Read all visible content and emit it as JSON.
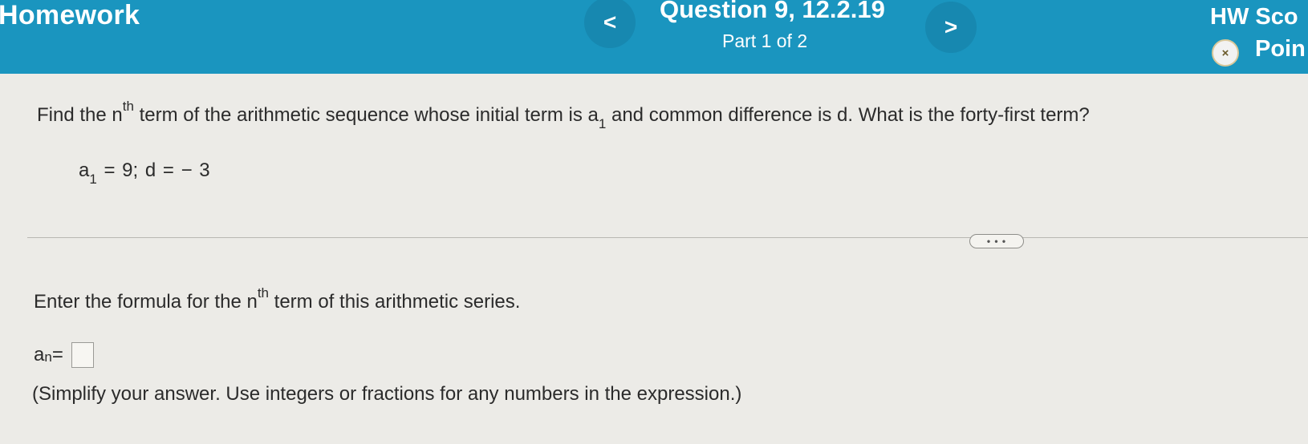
{
  "header": {
    "title": "Homework",
    "prev_label": "<",
    "next_label": ">",
    "question_title": "Question 9, 12.2.19",
    "part_label": "Part 1 of 2",
    "score_title": "HW Sco",
    "score_icon_symbol": "×",
    "points_label": "Poin",
    "color": "#1a95bf"
  },
  "problem": {
    "prompt_pre": "Find the n",
    "prompt_sup": "th",
    "prompt_mid": " term of the arithmetic sequence whose initial term is a",
    "prompt_sub": "1",
    "prompt_post": " and common difference is d.  What is the forty-first term?",
    "given_a": "a",
    "given_sub": "1",
    "given_rest": " = 9;  d = − 3"
  },
  "more_button_label": "• • •",
  "part1": {
    "instruction_pre": "Enter the formula for the n",
    "instruction_sup": "th",
    "instruction_post": " term of this arithmetic series.",
    "answer_var": "a",
    "answer_sub": "n",
    "answer_eq": " =",
    "hint": "(Simplify your answer. Use integers or fractions for any numbers in the expression.)"
  }
}
